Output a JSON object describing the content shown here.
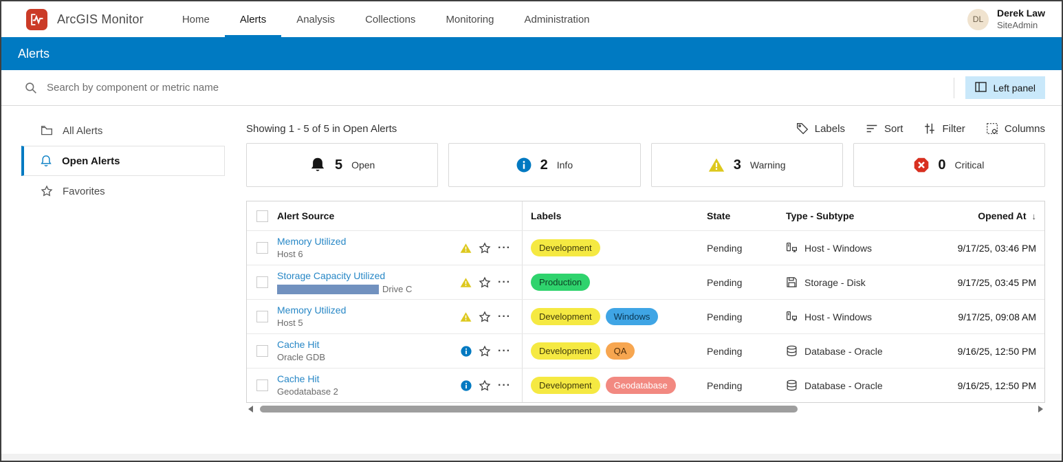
{
  "app": {
    "title": "ArcGIS Monitor"
  },
  "nav": {
    "items": [
      {
        "label": "Home",
        "active": false
      },
      {
        "label": "Alerts",
        "active": true
      },
      {
        "label": "Analysis",
        "active": false
      },
      {
        "label": "Collections",
        "active": false
      },
      {
        "label": "Monitoring",
        "active": false
      },
      {
        "label": "Administration",
        "active": false
      }
    ],
    "user": {
      "initials": "DL",
      "name": "Derek Law",
      "role": "SiteAdmin"
    }
  },
  "banner": {
    "title": "Alerts"
  },
  "search": {
    "placeholder": "Search by component or metric name",
    "left_panel_label": "Left panel"
  },
  "sidebar": {
    "items": [
      {
        "label": "All Alerts",
        "icon": "folder-icon",
        "active": false
      },
      {
        "label": "Open Alerts",
        "icon": "bell-icon",
        "active": true
      },
      {
        "label": "Favorites",
        "icon": "star-icon",
        "active": false
      }
    ]
  },
  "toolbar": {
    "showing_text": "Showing 1 - 5 of 5 in Open Alerts",
    "actions": [
      {
        "label": "Labels",
        "icon": "tag-icon"
      },
      {
        "label": "Sort",
        "icon": "sort-icon"
      },
      {
        "label": "Filter",
        "icon": "filter-icon"
      },
      {
        "label": "Columns",
        "icon": "columns-icon"
      }
    ]
  },
  "stats": [
    {
      "count": "5",
      "label": "Open",
      "icon": "bell-filled-icon"
    },
    {
      "count": "2",
      "label": "Info",
      "icon": "info-icon"
    },
    {
      "count": "3",
      "label": "Warning",
      "icon": "warning-icon"
    },
    {
      "count": "0",
      "label": "Critical",
      "icon": "critical-icon"
    }
  ],
  "table": {
    "headers": {
      "source": "Alert Source",
      "labels": "Labels",
      "state": "State",
      "type": "Type - Subtype",
      "opened": "Opened At"
    },
    "sorted_column": "opened",
    "sort_direction": "desc",
    "rows": [
      {
        "name": "Memory Utilized",
        "sub": "Host 6",
        "severity": "warning",
        "labels": [
          {
            "text": "Development",
            "bg": "#f5e942",
            "fg": "#3f3a0a"
          }
        ],
        "state": "Pending",
        "type": "Host - Windows",
        "type_icon": "host-icon",
        "opened": "9/17/25, 03:46 PM"
      },
      {
        "name": "Storage Capacity Utilized",
        "sub": "Drive C",
        "meter": true,
        "severity": "warning",
        "labels": [
          {
            "text": "Production",
            "bg": "#2fd36d",
            "fg": "#0c3d22"
          }
        ],
        "state": "Pending",
        "type": "Storage - Disk",
        "type_icon": "disk-icon",
        "opened": "9/17/25, 03:45 PM"
      },
      {
        "name": "Memory Utilized",
        "sub": "Host 5",
        "severity": "warning",
        "labels": [
          {
            "text": "Development",
            "bg": "#f5e942",
            "fg": "#3f3a0a"
          },
          {
            "text": "Windows",
            "bg": "#3fa5e5",
            "fg": "#0a3550"
          }
        ],
        "state": "Pending",
        "type": "Host - Windows",
        "type_icon": "host-icon",
        "opened": "9/17/25, 09:08 AM"
      },
      {
        "name": "Cache Hit",
        "sub": "Oracle GDB",
        "severity": "info",
        "labels": [
          {
            "text": "Development",
            "bg": "#f5e942",
            "fg": "#3f3a0a"
          },
          {
            "text": "QA",
            "bg": "#f7a650",
            "fg": "#4f2d08"
          }
        ],
        "state": "Pending",
        "type": "Database - Oracle",
        "type_icon": "database-icon",
        "opened": "9/16/25, 12:50 PM"
      },
      {
        "name": "Cache Hit",
        "sub": "Geodatabase 2",
        "severity": "info",
        "labels": [
          {
            "text": "Development",
            "bg": "#f5e942",
            "fg": "#3f3a0a"
          },
          {
            "text": "Geodatabase",
            "bg": "#f28981",
            "fg": "#ffffff"
          }
        ],
        "state": "Pending",
        "type": "Database - Oracle",
        "type_icon": "database-icon",
        "opened": "9/16/25, 12:50 PM"
      }
    ]
  },
  "colors": {
    "accent_blue": "#007ac2",
    "link_blue": "#2787c6",
    "warning_yellow": "#ddc81d",
    "info_blue": "#0079c1",
    "critical_red": "#d83020",
    "meter_blue": "#7191bf",
    "left_panel_button_bg": "#c9e8fa",
    "logo_red": "#cb3b27",
    "avatar_bg": "#f0e3cf"
  }
}
